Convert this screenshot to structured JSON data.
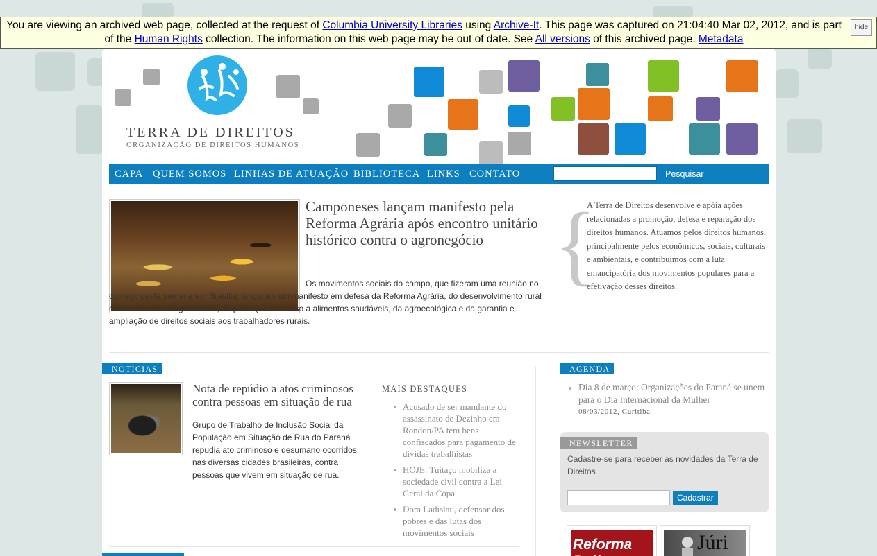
{
  "archive": {
    "t1": "You are viewing an archived web page, collected at the request of ",
    "link_columbia": "Columbia University Libraries",
    "t2": " using ",
    "link_archiveit": "Archive-It",
    "t3": ". This page was captured on 21:04:40 Mar 02, 2012, and is part of the ",
    "link_hr": "Human Rights",
    "t4": " collection. The information on this web page may be out of date. See ",
    "link_versions": "All versions",
    "t5": " of this archived page. ",
    "link_metadata": "Metadata",
    "hide": "hide"
  },
  "header": {
    "title": "Terra de Direitos",
    "subtitle": "Organização de Direitos Humanos"
  },
  "nav": {
    "items": [
      "CAPA",
      "QUEM SOMOS",
      "LINHAS DE ATUAÇÃO",
      "BIBLIOTECA",
      "LINKS",
      "CONTATO"
    ],
    "search_placeholder": "",
    "search_button": "Pesquisar"
  },
  "featured": {
    "title": "Camponeses lançam manifesto pela Reforma Agrária após encontro unitário histórico contra o agronegócio",
    "body": "Os movimentos sociais do campo, que fizeram uma reunião no começo desta semana em Brasília, lançaram um manifesto em defesa da Reforma Agrária, do desenvolvimento rural com o fim das desigualdades, da produção e acesso a alimentos saudáveis, da agroecológica e da garantia e ampliação de direitos sociais aos trabalhadores rurais."
  },
  "about": {
    "text": "A Terra de Direitos desenvolve e apóia ações relacionadas a promoção, defesa e reparação dos direitos humanos. Atuamos pelos direitos humanos, principalmente pelos econômicos, sociais, culturais e ambientais, e contribuimos com a luta emancipatória dos movimentos populares para a efetivação desses direitos."
  },
  "noticias": {
    "tag": "NOTÍCIAS",
    "title": "Nota de repúdio a atos criminosos contra pessoas em situação de rua",
    "body": "Grupo de Trabalho de Inclusão Social da População em Situação de Rua do Paraná repudia ato criminoso e desumano ocorridos nas diversas cidades brasileiras, contra pessoas que vivem em situação de rua."
  },
  "mais_destaques": {
    "heading": "MAIS DESTAQUES",
    "items": [
      "Acusado de ser mandante do assassinato de Dezinho em Rondon/PA tem bens confiscados para pagamento de dividas trabalhistas",
      "HOJE: Tuitaço mobiliza a sociedade civil contra a Lei Geral da Copa",
      "Dom Ladislau, defensor dos pobres e das lutas dos movimentos sociais"
    ]
  },
  "agenda": {
    "tag": "AGENDA",
    "item_title": "Dia 8 de março: Organizações do Paraná se unem para o Dia Internacional da Mulher",
    "item_meta": "08/03/2012, Curitiba"
  },
  "newsletter": {
    "tag": "NEWSLETTER",
    "text": "Cadastre-se para receber as novidades da Terra de Direitos",
    "button": "Cadastrar"
  },
  "banners": {
    "reforma": "Reforma Polít",
    "juri": "Júri"
  },
  "colors": {
    "accent_blue": "#0e7fbe",
    "tag_gray": "#999999",
    "logo_blue": "#2fb0e6"
  }
}
